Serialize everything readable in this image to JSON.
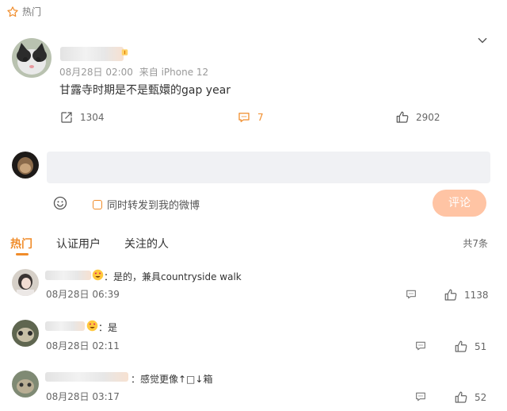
{
  "section": {
    "title": "热门"
  },
  "post": {
    "meta_time": "08月28日 02:00",
    "meta_source": "来自 iPhone 12",
    "content": "甘露寺时期是不是甄嬛的gap year",
    "reposts": "1304",
    "comments": "7",
    "likes": "2902"
  },
  "composer": {
    "placeholder": "",
    "sync_label": "同时转发到我的微博",
    "submit_label": "评论"
  },
  "tabs": [
    {
      "label": "热门"
    },
    {
      "label": "认证用户"
    },
    {
      "label": "关注的人"
    }
  ],
  "total_label": "共7条",
  "comments": [
    {
      "text": "：是的，兼具countryside walk",
      "time": "08月28日 06:39",
      "likes": "1138"
    },
    {
      "text": "：是",
      "time": "08月28日 02:11",
      "likes": "51"
    },
    {
      "text": "：感觉更像↑□↓箱",
      "time": "08月28日 03:17",
      "likes": "52"
    }
  ],
  "colors": {
    "accent": "#f08c2a",
    "button_disabled": "#ffc4a4",
    "input_bg": "#f0f1f4"
  }
}
